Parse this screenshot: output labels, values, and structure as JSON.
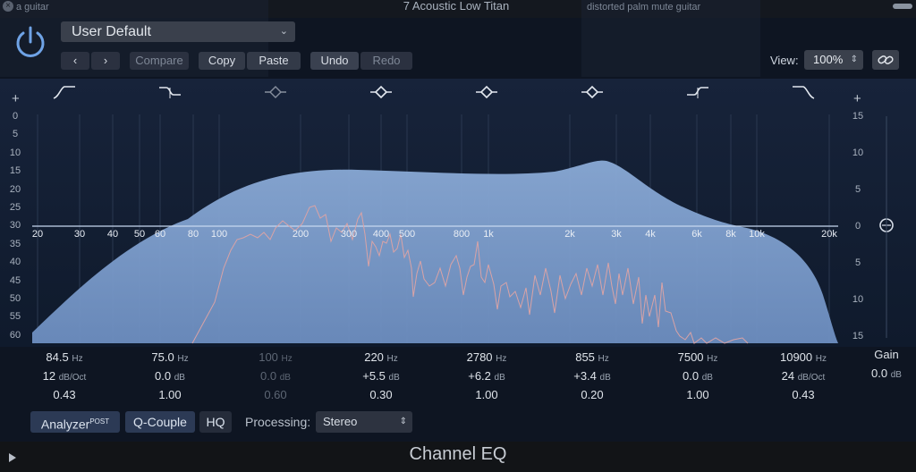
{
  "window": {
    "track_title": "7 Acoustic Low Titan",
    "ghost_left": "a guitar",
    "ghost_right": "distorted palm mute guitar",
    "plugin_name": "Channel EQ"
  },
  "header": {
    "preset": "User Default",
    "compare": "Compare",
    "copy": "Copy",
    "paste": "Paste",
    "undo": "Undo",
    "redo": "Redo",
    "view_label": "View:",
    "view_value": "100%"
  },
  "graph": {
    "left_scale": [
      "0",
      "5",
      "10",
      "15",
      "20",
      "25",
      "30",
      "35",
      "40",
      "45",
      "50",
      "55",
      "60"
    ],
    "right_scale": [
      "15",
      "10",
      "5",
      "0",
      "5",
      "10",
      "15"
    ],
    "frequency_labels": [
      "20",
      "30",
      "40",
      "50",
      "60",
      "80",
      "100",
      "200",
      "300",
      "400",
      "500",
      "800",
      "1k",
      "2k",
      "3k",
      "4k",
      "6k",
      "8k",
      "10k",
      "20k"
    ],
    "band_icons": [
      "low-cut-icon",
      "low-shelf-icon",
      "bell-icon",
      "bell-icon",
      "bell-icon",
      "bell-icon",
      "high-shelf-icon",
      "high-cut-icon"
    ]
  },
  "bands": [
    {
      "freq": "84.5",
      "freq_unit": "Hz",
      "gain": "12",
      "gain_unit": "dB/Oct",
      "q": "0.43",
      "enabled": true
    },
    {
      "freq": "75.0",
      "freq_unit": "Hz",
      "gain": "0.0",
      "gain_unit": "dB",
      "q": "1.00",
      "enabled": true
    },
    {
      "freq": "100",
      "freq_unit": "Hz",
      "gain": "0.0",
      "gain_unit": "dB",
      "q": "0.60",
      "enabled": false
    },
    {
      "freq": "220",
      "freq_unit": "Hz",
      "gain": "+5.5",
      "gain_unit": "dB",
      "q": "0.30",
      "enabled": true
    },
    {
      "freq": "2780",
      "freq_unit": "Hz",
      "gain": "+6.2",
      "gain_unit": "dB",
      "q": "1.00",
      "enabled": true
    },
    {
      "freq": "855",
      "freq_unit": "Hz",
      "gain": "+3.4",
      "gain_unit": "dB",
      "q": "0.20",
      "enabled": true
    },
    {
      "freq": "7500",
      "freq_unit": "Hz",
      "gain": "0.0",
      "gain_unit": "dB",
      "q": "1.00",
      "enabled": true
    },
    {
      "freq": "10900",
      "freq_unit": "Hz",
      "gain": "24",
      "gain_unit": "dB/Oct",
      "q": "0.43",
      "enabled": true
    }
  ],
  "master": {
    "label": "Gain",
    "value": "0.0",
    "unit": "dB"
  },
  "footer": {
    "analyzer": "Analyzer",
    "analyzer_sup": "POST",
    "q_couple": "Q-Couple",
    "hq": "HQ",
    "processing_label": "Processing:",
    "processing_value": "Stereo"
  },
  "colors": {
    "accent": "#6fa3e6",
    "curve_fill": "#86a6d4",
    "analyzer": "#d9a3a6"
  }
}
